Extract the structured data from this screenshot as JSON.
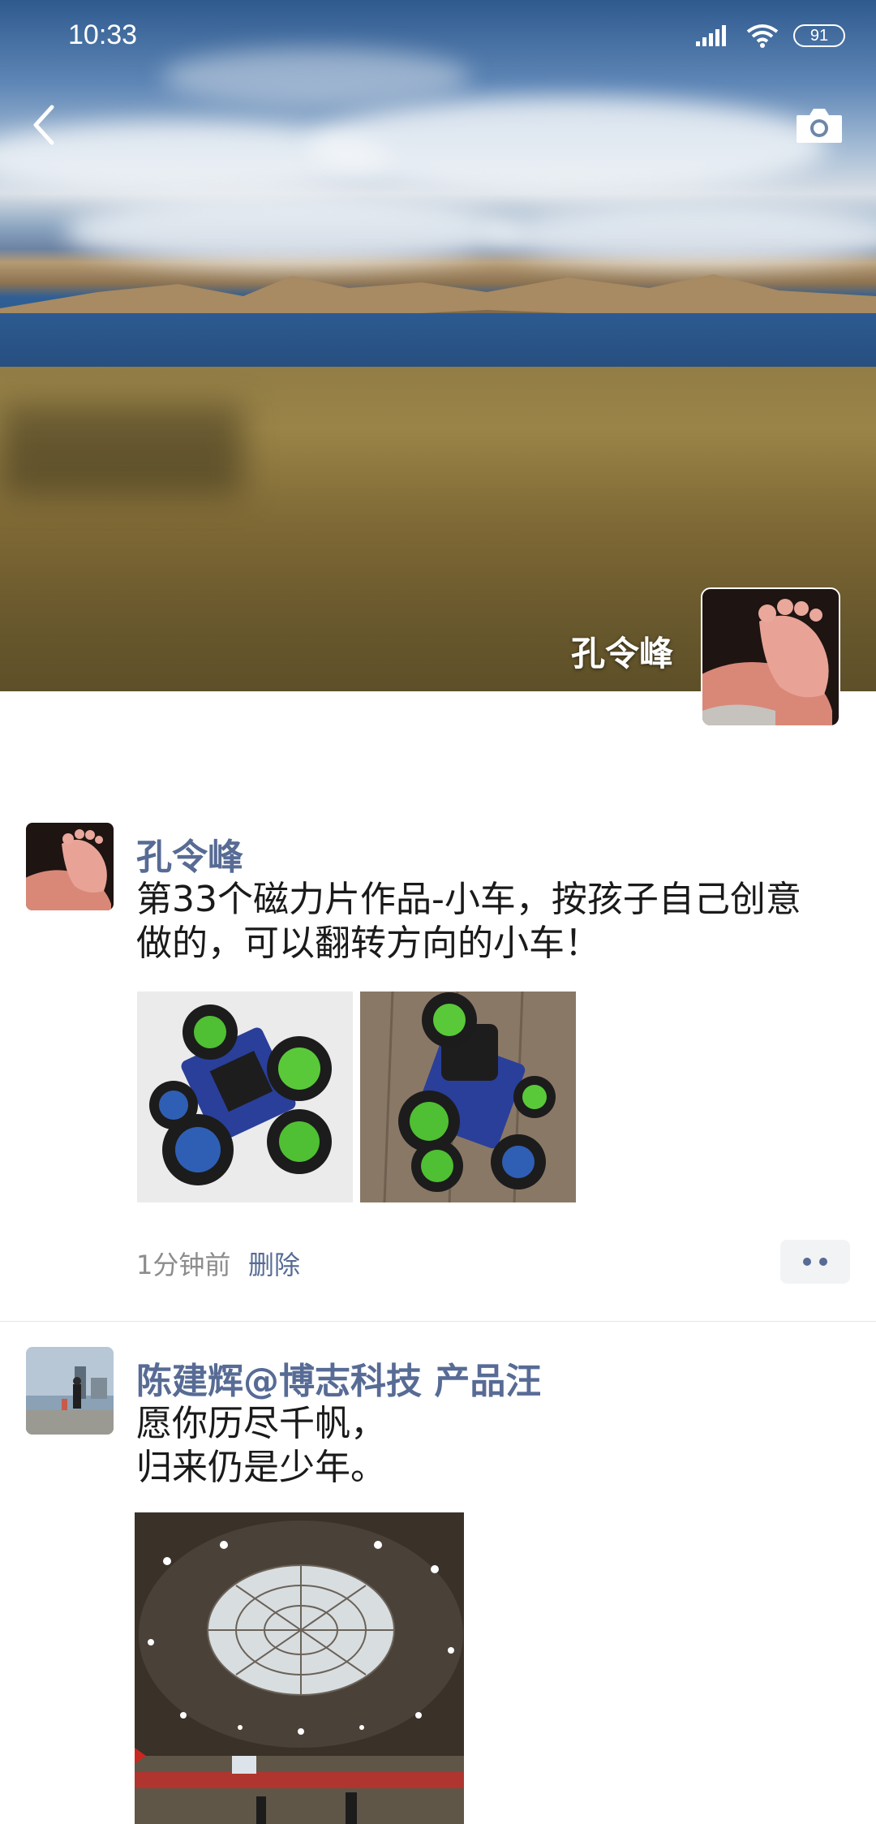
{
  "status_bar": {
    "time": "10:33",
    "battery": "91"
  },
  "header": {
    "back_icon": "chevron-left-icon",
    "camera_icon": "camera-icon",
    "profile_name": "孔令峰"
  },
  "posts": [
    {
      "author": "孔令峰",
      "text": "第33个磁力片作品-小车，按孩子自己创意\n做的，可以翻转方向的小车！",
      "time": "1分钟前",
      "delete_label": "删除",
      "image_count": 2
    },
    {
      "author": "陈建辉@博志科技 产品汪",
      "text": "愿你历尽千帆，\n归来仍是少年。",
      "image_count": 1
    }
  ],
  "colors": {
    "link": "#576b95",
    "meta": "#8c8c8c",
    "text": "#1a1a1a"
  }
}
